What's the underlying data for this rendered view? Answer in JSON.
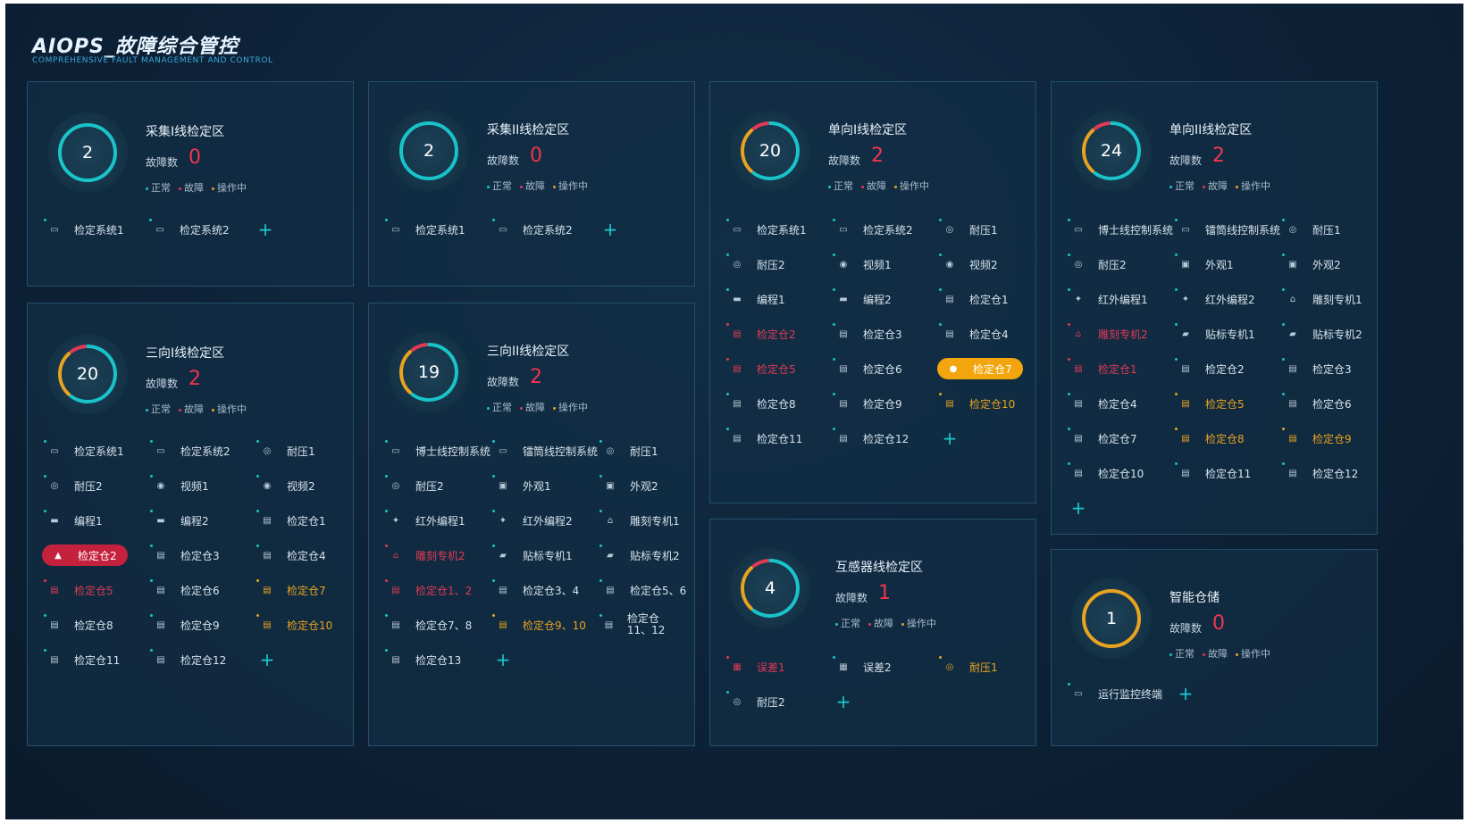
{
  "header": {
    "title": "AIOPS_故障综合管控",
    "subtitle": "COMPREHENSIVE FAULT MANAGEMENT AND CONTROL"
  },
  "legend_labels": {
    "normal": "正常",
    "fault": "故障",
    "operating": "操作中"
  },
  "fault_label": "故障数",
  "colors": {
    "normal": "#19c3c9",
    "fault": "#e03a55",
    "operating": "#e8a321"
  },
  "panels": [
    {
      "title": "采集I线检定区",
      "total": "2",
      "faults": "0",
      "ring": {
        "normal": 1,
        "fault": 0,
        "operating": 0
      },
      "items": [
        {
          "label": "检定系统1",
          "icon": "monitor-icon",
          "status": "normal"
        },
        {
          "label": "检定系统2",
          "icon": "monitor-icon",
          "status": "normal"
        }
      ]
    },
    {
      "title": "采集II线检定区",
      "total": "2",
      "faults": "0",
      "ring": {
        "normal": 1,
        "fault": 0,
        "operating": 0
      },
      "items": [
        {
          "label": "检定系统1",
          "icon": "monitor-icon",
          "status": "normal"
        },
        {
          "label": "检定系统2",
          "icon": "monitor-icon",
          "status": "normal"
        }
      ]
    },
    {
      "title": "单向I线检定区",
      "total": "20",
      "faults": "2",
      "ring": {
        "normal": 0.62,
        "fault": 0.1,
        "operating": 0.28
      },
      "items": [
        {
          "label": "检定系统1",
          "icon": "monitor-icon",
          "status": "normal"
        },
        {
          "label": "检定系统2",
          "icon": "monitor-icon",
          "status": "normal"
        },
        {
          "label": "耐压1",
          "icon": "gauge-icon",
          "status": "normal"
        },
        {
          "label": "耐压2",
          "icon": "gauge-icon",
          "status": "normal"
        },
        {
          "label": "视频1",
          "icon": "camera-icon",
          "status": "normal"
        },
        {
          "label": "视频2",
          "icon": "camera-icon",
          "status": "normal"
        },
        {
          "label": "编程1",
          "icon": "laptop-icon",
          "status": "normal"
        },
        {
          "label": "编程2",
          "icon": "laptop-icon",
          "status": "normal"
        },
        {
          "label": "检定仓1",
          "icon": "bin-icon",
          "status": "normal"
        },
        {
          "label": "检定仓2",
          "icon": "bin-icon",
          "status": "fault"
        },
        {
          "label": "检定仓3",
          "icon": "bin-icon",
          "status": "normal"
        },
        {
          "label": "检定仓4",
          "icon": "bin-icon",
          "status": "normal"
        },
        {
          "label": "检定仓5",
          "icon": "bin-icon",
          "status": "fault"
        },
        {
          "label": "检定仓6",
          "icon": "bin-icon",
          "status": "normal"
        },
        {
          "label": "检定仓7",
          "icon": "person-icon",
          "status": "op-pill"
        },
        {
          "label": "检定仓8",
          "icon": "bin-icon",
          "status": "normal"
        },
        {
          "label": "检定仓9",
          "icon": "bin-icon",
          "status": "normal"
        },
        {
          "label": "检定仓10",
          "icon": "bin-icon",
          "status": "op"
        },
        {
          "label": "检定仓11",
          "icon": "bin-icon",
          "status": "normal"
        },
        {
          "label": "检定仓12",
          "icon": "bin-icon",
          "status": "normal"
        }
      ]
    },
    {
      "title": "单向II线检定区",
      "total": "24",
      "faults": "2",
      "ring": {
        "normal": 0.62,
        "fault": 0.1,
        "operating": 0.28
      },
      "items": [
        {
          "label": "博士线控制系统",
          "icon": "monitor-icon",
          "status": "normal"
        },
        {
          "label": "镭筒线控制系统",
          "icon": "monitor-icon",
          "status": "normal"
        },
        {
          "label": "耐压1",
          "icon": "gauge-icon",
          "status": "normal"
        },
        {
          "label": "耐压2",
          "icon": "gauge-icon",
          "status": "normal"
        },
        {
          "label": "外观1",
          "icon": "box-icon",
          "status": "normal"
        },
        {
          "label": "外观2",
          "icon": "box-icon",
          "status": "normal"
        },
        {
          "label": "红外编程1",
          "icon": "infrared-icon",
          "status": "normal"
        },
        {
          "label": "红外编程2",
          "icon": "infrared-icon",
          "status": "normal"
        },
        {
          "label": "雕刻专机1",
          "icon": "engraver-icon",
          "status": "normal"
        },
        {
          "label": "雕刻专机2",
          "icon": "engraver-icon",
          "status": "fault"
        },
        {
          "label": "贴标专机1",
          "icon": "label-icon",
          "status": "normal"
        },
        {
          "label": "贴标专机2",
          "icon": "label-icon",
          "status": "normal"
        },
        {
          "label": "检定仓1",
          "icon": "bin-icon",
          "status": "fault"
        },
        {
          "label": "检定仓2",
          "icon": "bin-icon",
          "status": "normal"
        },
        {
          "label": "检定仓3",
          "icon": "bin-icon",
          "status": "normal"
        },
        {
          "label": "检定仓4",
          "icon": "bin-icon",
          "status": "normal"
        },
        {
          "label": "检定仓5",
          "icon": "bin-icon",
          "status": "op"
        },
        {
          "label": "检定仓6",
          "icon": "bin-icon",
          "status": "normal"
        },
        {
          "label": "检定仓7",
          "icon": "bin-icon",
          "status": "normal"
        },
        {
          "label": "检定仓8",
          "icon": "bin-icon",
          "status": "op"
        },
        {
          "label": "检定仓9",
          "icon": "bin-icon",
          "status": "op"
        },
        {
          "label": "检定仓10",
          "icon": "bin-icon",
          "status": "normal"
        },
        {
          "label": "检定仓11",
          "icon": "bin-icon",
          "status": "normal"
        },
        {
          "label": "检定仓12",
          "icon": "bin-icon",
          "status": "normal"
        }
      ]
    },
    {
      "title": "三向I线检定区",
      "total": "20",
      "faults": "2",
      "ring": {
        "normal": 0.62,
        "fault": 0.1,
        "operating": 0.28
      },
      "items": [
        {
          "label": "检定系统1",
          "icon": "monitor-icon",
          "status": "normal"
        },
        {
          "label": "检定系统2",
          "icon": "monitor-icon",
          "status": "normal"
        },
        {
          "label": "耐压1",
          "icon": "gauge-icon",
          "status": "normal"
        },
        {
          "label": "耐压2",
          "icon": "gauge-icon",
          "status": "normal"
        },
        {
          "label": "视频1",
          "icon": "camera-icon",
          "status": "normal"
        },
        {
          "label": "视频2",
          "icon": "camera-icon",
          "status": "normal"
        },
        {
          "label": "编程1",
          "icon": "laptop-icon",
          "status": "normal"
        },
        {
          "label": "编程2",
          "icon": "laptop-icon",
          "status": "normal"
        },
        {
          "label": "检定仓1",
          "icon": "bin-icon",
          "status": "normal"
        },
        {
          "label": "检定仓2",
          "icon": "bell-icon",
          "status": "fault-pill"
        },
        {
          "label": "检定仓3",
          "icon": "bin-icon",
          "status": "normal"
        },
        {
          "label": "检定仓4",
          "icon": "bin-icon",
          "status": "normal"
        },
        {
          "label": "检定仓5",
          "icon": "bin-icon",
          "status": "fault"
        },
        {
          "label": "检定仓6",
          "icon": "bin-icon",
          "status": "normal"
        },
        {
          "label": "检定仓7",
          "icon": "bin-icon",
          "status": "op"
        },
        {
          "label": "检定仓8",
          "icon": "bin-icon",
          "status": "normal"
        },
        {
          "label": "检定仓9",
          "icon": "bin-icon",
          "status": "normal"
        },
        {
          "label": "检定仓10",
          "icon": "bin-icon",
          "status": "op"
        },
        {
          "label": "检定仓11",
          "icon": "bin-icon",
          "status": "normal"
        },
        {
          "label": "检定仓12",
          "icon": "bin-icon",
          "status": "normal"
        }
      ]
    },
    {
      "title": "三向II线检定区",
      "total": "19",
      "faults": "2",
      "ring": {
        "normal": 0.62,
        "fault": 0.1,
        "operating": 0.28
      },
      "items": [
        {
          "label": "博士线控制系统",
          "icon": "monitor-icon",
          "status": "normal"
        },
        {
          "label": "镭筒线控制系统",
          "icon": "monitor-icon",
          "status": "normal"
        },
        {
          "label": "耐压1",
          "icon": "gauge-icon",
          "status": "normal"
        },
        {
          "label": "耐压2",
          "icon": "gauge-icon",
          "status": "normal"
        },
        {
          "label": "外观1",
          "icon": "box-icon",
          "status": "normal"
        },
        {
          "label": "外观2",
          "icon": "box-icon",
          "status": "normal"
        },
        {
          "label": "红外编程1",
          "icon": "infrared-icon",
          "status": "normal"
        },
        {
          "label": "红外编程2",
          "icon": "infrared-icon",
          "status": "normal"
        },
        {
          "label": "雕刻专机1",
          "icon": "engraver-icon",
          "status": "normal"
        },
        {
          "label": "雕刻专机2",
          "icon": "engraver-icon",
          "status": "fault"
        },
        {
          "label": "贴标专机1",
          "icon": "label-icon",
          "status": "normal"
        },
        {
          "label": "贴标专机2",
          "icon": "label-icon",
          "status": "normal"
        },
        {
          "label": "检定仓1、2",
          "icon": "bin-icon",
          "status": "fault"
        },
        {
          "label": "检定仓3、4",
          "icon": "bin-icon",
          "status": "normal"
        },
        {
          "label": "检定仓5、6",
          "icon": "bin-icon",
          "status": "normal"
        },
        {
          "label": "检定仓7、8",
          "icon": "bin-icon",
          "status": "normal"
        },
        {
          "label": "检定仓9、10",
          "icon": "bin-icon",
          "status": "op"
        },
        {
          "label": "检定仓11、12",
          "icon": "bin-icon",
          "status": "normal-wrap"
        },
        {
          "label": "检定仓13",
          "icon": "bin-icon",
          "status": "normal"
        }
      ]
    },
    {
      "title": "互感器线检定区",
      "total": "4",
      "faults": "1",
      "ring": {
        "normal": 0.62,
        "fault": 0.1,
        "operating": 0.28
      },
      "items": [
        {
          "label": "误差1",
          "icon": "meter-icon",
          "status": "fault"
        },
        {
          "label": "误差2",
          "icon": "meter-icon",
          "status": "normal"
        },
        {
          "label": "耐压1",
          "icon": "gauge-icon",
          "status": "op"
        },
        {
          "label": "耐压2",
          "icon": "gauge-icon",
          "status": "normal"
        }
      ]
    },
    {
      "title": "智能仓储",
      "total": "1",
      "faults": "0",
      "ring": {
        "normal": 0,
        "fault": 0,
        "operating": 1
      },
      "items": [
        {
          "label": "运行监控终端",
          "icon": "terminal-icon",
          "status": "normal"
        }
      ]
    }
  ]
}
